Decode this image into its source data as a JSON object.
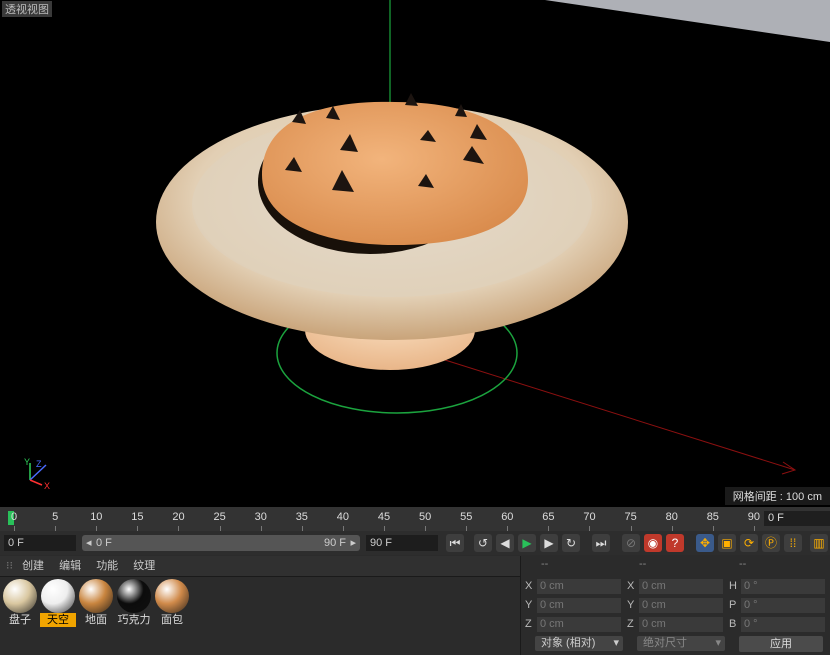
{
  "viewport": {
    "title": "透视视图",
    "grid_spacing": "网格间距 : 100 cm",
    "axis_labels": {
      "y": "Y",
      "z": "Z",
      "x": "X"
    }
  },
  "timeline": {
    "ticks": [
      "0",
      "5",
      "10",
      "15",
      "20",
      "25",
      "30",
      "35",
      "40",
      "45",
      "50",
      "55",
      "60",
      "65",
      "70",
      "75",
      "80",
      "85",
      "90"
    ],
    "current_frame_right": "0 F"
  },
  "transport": {
    "start_frame": "0 F",
    "range_start": "0 F",
    "range_end": "90 F",
    "end_frame": "90 F"
  },
  "materials": {
    "menu": [
      "创建",
      "编辑",
      "功能",
      "纹理"
    ],
    "items": [
      {
        "label": "盘子",
        "color": "#d9c7a0"
      },
      {
        "label": "天空",
        "color": "#eeeeee"
      },
      {
        "label": "地面",
        "color": "#c9853f"
      },
      {
        "label": "巧克力",
        "color": "#0c0c0c"
      },
      {
        "label": "面包",
        "color": "#d08a4a"
      }
    ],
    "selected_index": 1
  },
  "attributes": {
    "headers": [
      "--",
      "--",
      "--"
    ],
    "rows": [
      {
        "l1": "X",
        "v1": "0 cm",
        "l2": "X",
        "v2": "0 cm",
        "l3": "H",
        "v3": "0 °"
      },
      {
        "l1": "Y",
        "v1": "0 cm",
        "l2": "Y",
        "v2": "0 cm",
        "l3": "P",
        "v3": "0 °"
      },
      {
        "l1": "Z",
        "v1": "0 cm",
        "l2": "Z",
        "v2": "0 cm",
        "l3": "B",
        "v3": "0 °"
      }
    ],
    "coord_mode": "对象 (相对)",
    "size_mode": "绝对尺寸",
    "apply_label": "应用"
  }
}
